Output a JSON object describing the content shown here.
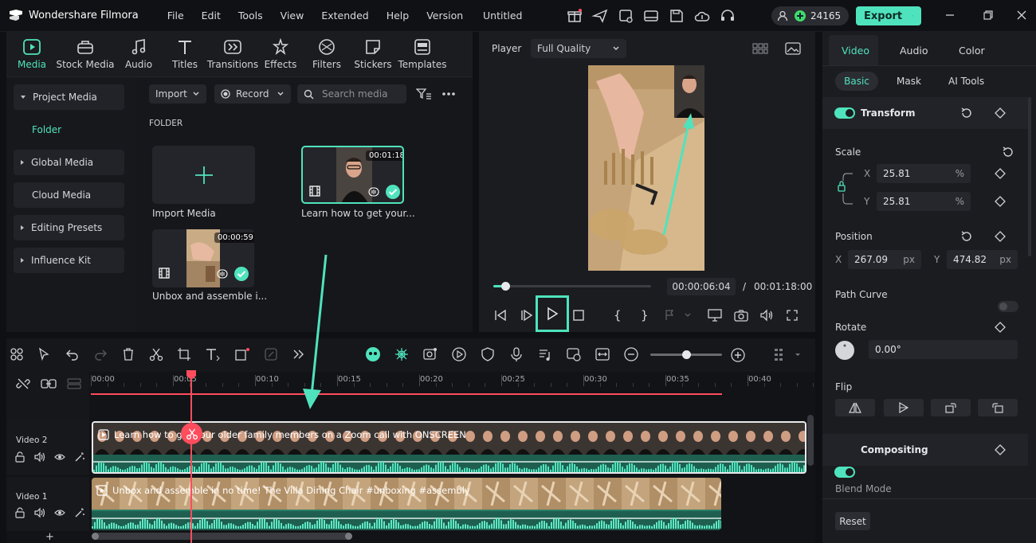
{
  "app": {
    "name": "Wondershare Filmora",
    "doc_title": "Untitled",
    "credits": "24165",
    "export_label": "Export"
  },
  "menu": [
    "File",
    "Edit",
    "Tools",
    "View",
    "Extended",
    "Help",
    "Version"
  ],
  "media_tabs": [
    {
      "label": "Media",
      "icon": "media-icon"
    },
    {
      "label": "Stock Media",
      "icon": "stock-media-icon"
    },
    {
      "label": "Audio",
      "icon": "audio-icon"
    },
    {
      "label": "Titles",
      "icon": "titles-icon"
    },
    {
      "label": "Transitions",
      "icon": "transitions-icon"
    },
    {
      "label": "Effects",
      "icon": "effects-icon"
    },
    {
      "label": "Filters",
      "icon": "filters-icon"
    },
    {
      "label": "Stickers",
      "icon": "stickers-icon"
    },
    {
      "label": "Templates",
      "icon": "templates-icon"
    }
  ],
  "sidebar": [
    "Project Media",
    "Folder",
    "Global Media",
    "Cloud Media",
    "Editing Presets",
    "Influence Kit"
  ],
  "media_toolbar": {
    "import": "Import",
    "record": "Record",
    "search_placeholder": "Search media"
  },
  "folder_label": "FOLDER",
  "media_items": [
    {
      "label": "Import Media"
    },
    {
      "label": "Learn how to get your...",
      "duration": "00:01:18"
    },
    {
      "label": "Unbox and assemble i...",
      "duration": "00:00:59"
    }
  ],
  "player": {
    "label": "Player",
    "quality": "Full Quality",
    "current": "00:00:06:04",
    "separator": "/",
    "total": "00:01:18:00",
    "progress": 0.078
  },
  "props": {
    "tabs": [
      "Video",
      "Audio",
      "Color"
    ],
    "subtabs": [
      "Basic",
      "Mask",
      "AI Tools"
    ],
    "transform": "Transform",
    "scale": "Scale",
    "scale_x": "25.81",
    "scale_y": "25.81",
    "pct": "%",
    "position": "Position",
    "pos_x": "267.09",
    "pos_y": "474.82",
    "px": "px",
    "x": "X",
    "y": "Y",
    "path_curve": "Path Curve",
    "rotate": "Rotate",
    "rotate_val": "0.00°",
    "flip": "Flip",
    "compositing": "Compositing",
    "blend_mode": "Blend Mode",
    "reset": "Reset"
  },
  "ruler": [
    "00:00",
    "00:05",
    "00:10",
    "00:15",
    "00:20",
    "00:25",
    "00:30",
    "00:35",
    "00:40"
  ],
  "tracks": [
    {
      "name": "Video 2",
      "clip": "Learn how to get your older family members on a Zoom call with ONSCREEN"
    },
    {
      "name": "Video 1",
      "clip": "Unbox and assemble in no time!  The Villa Dining Chair #unboxing #assembly"
    }
  ],
  "colors": {
    "accent": "#4fe3bd",
    "playhead": "#ff4d5e"
  }
}
